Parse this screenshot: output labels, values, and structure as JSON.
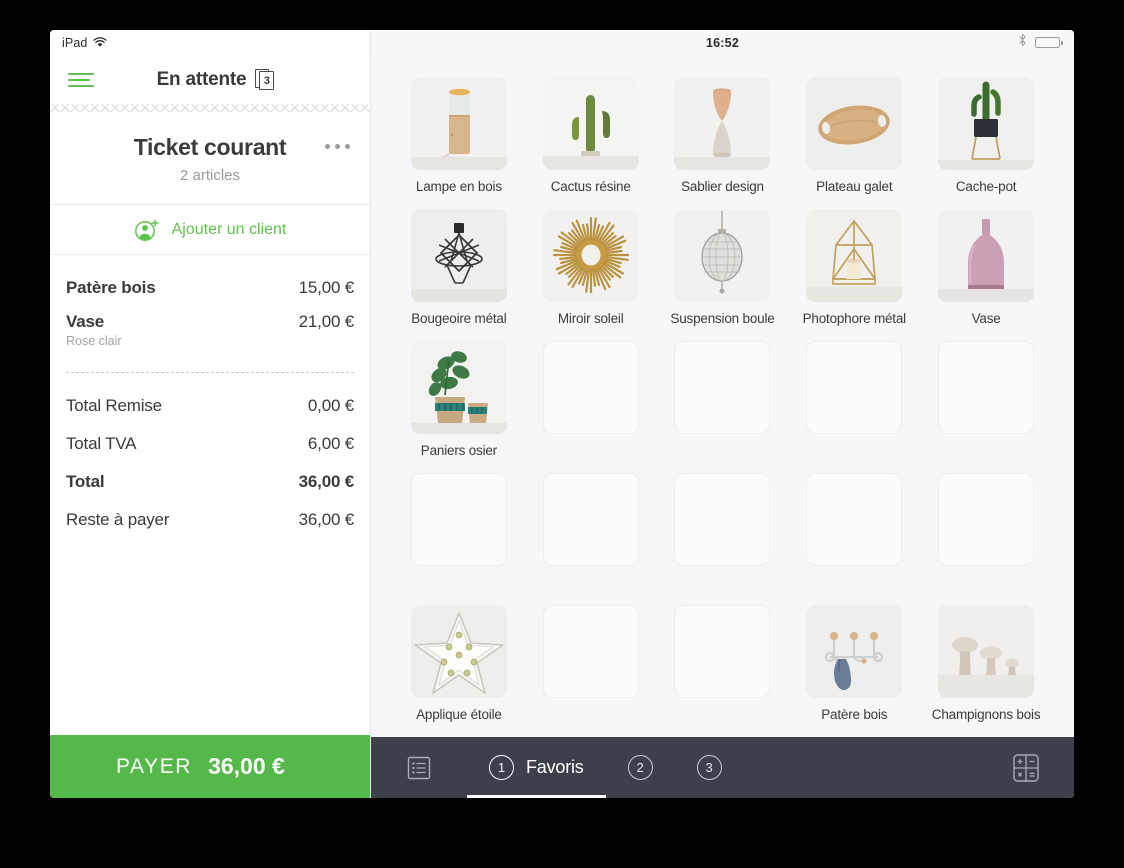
{
  "status_bar": {
    "device_label": "iPad",
    "wifi_icon": "wifi-icon",
    "time": "16:52",
    "bluetooth_icon": "bluetooth-icon",
    "battery_icon": "battery-icon"
  },
  "ticket_panel": {
    "menu_icon": "hamburger-menu-icon",
    "pending_label": "En attente",
    "pending_count": "3",
    "title": "Ticket courant",
    "subtitle": "2 articles",
    "overflow_icon": "more-options-icon",
    "add_client_label": "Ajouter un client",
    "add_client_icon": "add-person-icon",
    "line_items": [
      {
        "name": "Patère bois",
        "price": "15,00 €",
        "variant": ""
      },
      {
        "name": "Vase",
        "price": "21,00 €",
        "variant": "Rose clair"
      }
    ],
    "totals": [
      {
        "label": "Total Remise",
        "value": "0,00 €",
        "bold": false
      },
      {
        "label": "Total TVA",
        "value": "6,00 €",
        "bold": false
      },
      {
        "label": "Total",
        "value": "36,00 €",
        "bold": true
      },
      {
        "label": "Reste à payer",
        "value": "36,00 €",
        "bold": false
      }
    ],
    "pay_label": "PAYER",
    "pay_amount": "36,00 €"
  },
  "catalog": {
    "products": [
      {
        "label": "Lampe en bois",
        "image": "lampe-en-bois",
        "empty": false
      },
      {
        "label": "Cactus résine",
        "image": "cactus-resine",
        "empty": false
      },
      {
        "label": "Sablier design",
        "image": "sablier-design",
        "empty": false
      },
      {
        "label": "Plateau galet",
        "image": "plateau-galet",
        "empty": false
      },
      {
        "label": "Cache-pot",
        "image": "cache-pot",
        "empty": false
      },
      {
        "label": "Bougeoire métal",
        "image": "bougeoire-metal",
        "empty": false
      },
      {
        "label": "Miroir soleil",
        "image": "miroir-soleil",
        "empty": false
      },
      {
        "label": "Suspension boule",
        "image": "suspension-boule",
        "empty": false
      },
      {
        "label": "Photophore métal",
        "image": "photophore-metal",
        "empty": false
      },
      {
        "label": "Vase",
        "image": "vase",
        "empty": false
      },
      {
        "label": "Paniers osier",
        "image": "paniers-osier",
        "empty": false
      },
      {
        "label": "",
        "image": "",
        "empty": true
      },
      {
        "label": "",
        "image": "",
        "empty": true
      },
      {
        "label": "",
        "image": "",
        "empty": true
      },
      {
        "label": "",
        "image": "",
        "empty": true
      },
      {
        "label": "",
        "image": "",
        "empty": true
      },
      {
        "label": "",
        "image": "",
        "empty": true
      },
      {
        "label": "",
        "image": "",
        "empty": true
      },
      {
        "label": "",
        "image": "",
        "empty": true
      },
      {
        "label": "",
        "image": "",
        "empty": true
      },
      {
        "label": "Applique étoile",
        "image": "applique-etoile",
        "empty": false
      },
      {
        "label": "",
        "image": "",
        "empty": true
      },
      {
        "label": "",
        "image": "",
        "empty": true
      },
      {
        "label": "Patère bois",
        "image": "patere-bois",
        "empty": false
      },
      {
        "label": "Champignons bois",
        "image": "champignons-bois",
        "empty": false
      }
    ]
  },
  "tabbar": {
    "list_icon": "list-view-icon",
    "calculator_icon": "calculator-icon",
    "tabs": [
      {
        "number": "1",
        "label": "Favoris",
        "active": true
      },
      {
        "number": "2",
        "label": "",
        "active": false
      },
      {
        "number": "3",
        "label": "",
        "active": false
      }
    ]
  },
  "colors": {
    "accent_green": "#54b948",
    "tabbar_dark": "#3d3f4c",
    "catalog_bg": "#f6f7f9"
  }
}
